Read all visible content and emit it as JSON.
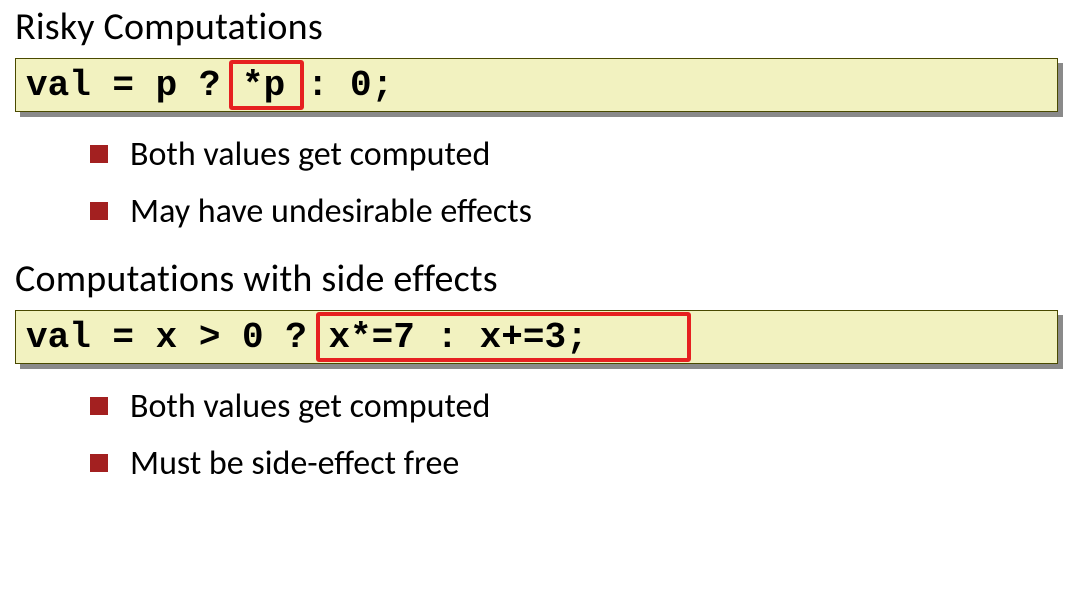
{
  "section1": {
    "heading": "Risky Computations",
    "code": "val = p ? *p : 0;",
    "bullets": [
      "Both values get computed",
      "May have undesirable effects"
    ]
  },
  "section2": {
    "heading": "Computations with side effects",
    "code": "val = x > 0 ? x*=7 : x+=3;",
    "bullets": [
      "Both values get computed",
      "Must be side-effect free"
    ]
  }
}
